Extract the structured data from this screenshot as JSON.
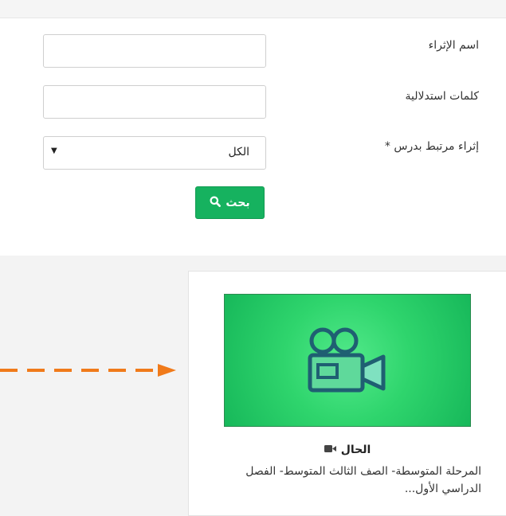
{
  "form": {
    "name_label": "اسم الإثراء",
    "keywords_label": "كلمات استدلالية",
    "lesson_label": "إثراء مرتبط بدرس *",
    "name_value": "",
    "keywords_value": "",
    "lesson_selected": "الكل",
    "search_label": "بحث"
  },
  "card": {
    "title": "الحال",
    "description": "المرحلة المتوسطة- الصف الثالث المتوسط- الفصل الدراسي الأول..."
  },
  "colors": {
    "accent": "#16b25f",
    "thumb_green": "#2fd56d",
    "annotation_arrow": "#f07a1a"
  },
  "icons": {
    "search": "search-icon",
    "video": "video-camera-icon",
    "select_arrow": "caret-down-icon"
  }
}
